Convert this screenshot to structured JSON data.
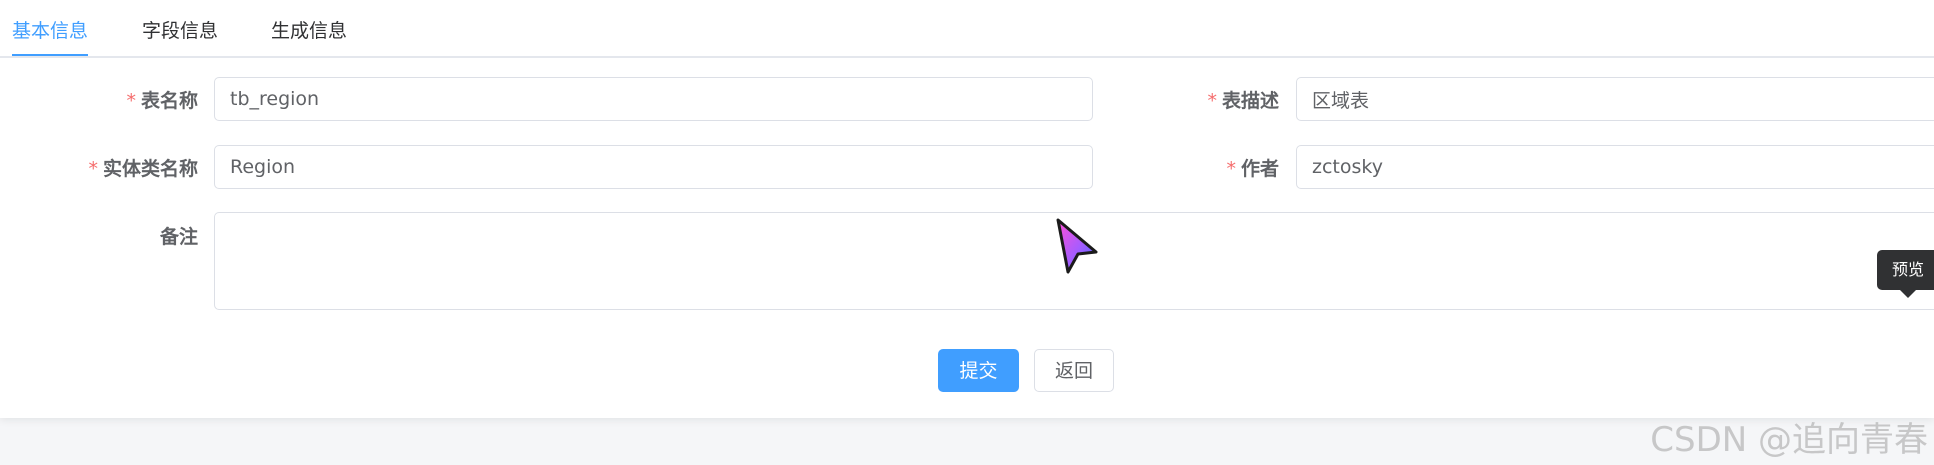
{
  "tabs": [
    {
      "label": "基本信息",
      "active": true
    },
    {
      "label": "字段信息",
      "active": false
    },
    {
      "label": "生成信息",
      "active": false
    }
  ],
  "form": {
    "required_mark": "*",
    "table_name": {
      "label": "表名称",
      "value": "tb_region",
      "required": true
    },
    "table_desc": {
      "label": "表描述",
      "value": "区域表",
      "required": true
    },
    "entity_name": {
      "label": "实体类名称",
      "value": "Region",
      "required": true
    },
    "author": {
      "label": "作者",
      "value": "zctosky",
      "required": true
    },
    "remark": {
      "label": "备注",
      "value": ""
    }
  },
  "actions": {
    "submit_label": "提交",
    "back_label": "返回"
  },
  "tooltip": {
    "text": "预览"
  },
  "watermark": {
    "text": "CSDN @追向青春"
  },
  "colors": {
    "primary": "#409eff",
    "required": "#f56c6c",
    "border": "#dcdfe6",
    "label": "#606266",
    "tooltip_bg": "#303133"
  },
  "icons": {
    "cursor": "pointer-cursor-icon"
  }
}
